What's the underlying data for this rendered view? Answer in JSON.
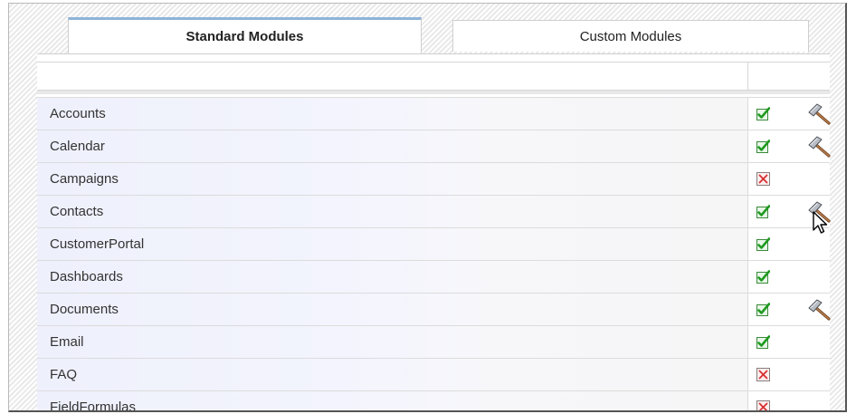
{
  "tabs": {
    "standard": "Standard Modules",
    "custom": "Custom Modules"
  },
  "colors": {
    "tab_accent": "#8fb3d9",
    "enabled_check": "#2a9d2a",
    "disabled_x": "#d03030"
  },
  "modules": [
    {
      "name": "Accounts",
      "enabled": true,
      "editable": true
    },
    {
      "name": "Calendar",
      "enabled": true,
      "editable": true
    },
    {
      "name": "Campaigns",
      "enabled": false,
      "editable": false
    },
    {
      "name": "Contacts",
      "enabled": true,
      "editable": true
    },
    {
      "name": "CustomerPortal",
      "enabled": true,
      "editable": false
    },
    {
      "name": "Dashboards",
      "enabled": true,
      "editable": false
    },
    {
      "name": "Documents",
      "enabled": true,
      "editable": true
    },
    {
      "name": "Email",
      "enabled": true,
      "editable": false
    },
    {
      "name": "FAQ",
      "enabled": false,
      "editable": false
    },
    {
      "name": "FieldFormulas",
      "enabled": false,
      "editable": false
    }
  ],
  "icons": {
    "enabled": "checkbox-checked-icon",
    "disabled": "checkbox-x-icon",
    "edit": "hammer-icon",
    "cursor": "mouse-pointer-icon"
  }
}
